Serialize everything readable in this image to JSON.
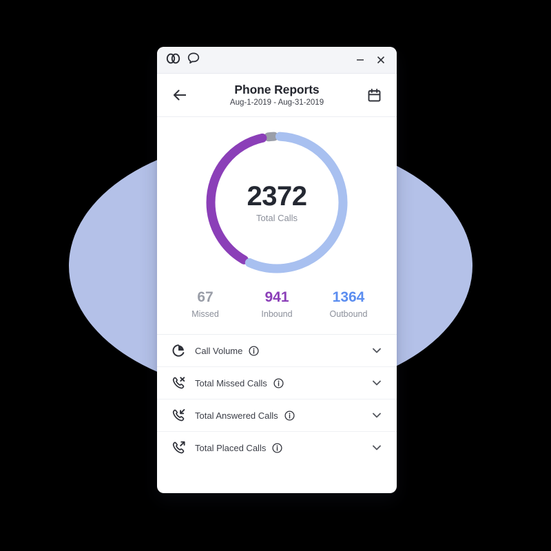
{
  "window": {
    "titlebar": {
      "logo_icon": "interlocking-rings-logo-icon",
      "chat_icon": "speech-bubble-icon",
      "minimize_label": "–",
      "close_label": "✕"
    },
    "header": {
      "back_icon": "arrow-left-icon",
      "title": "Phone Reports",
      "subtitle": "Aug-1-2019 - Aug-31-2019",
      "calendar_icon": "calendar-icon"
    }
  },
  "donut": {
    "total_value": "2372",
    "total_label": "Total Calls"
  },
  "stats": [
    {
      "value": "67",
      "label": "Missed",
      "color": "#9a9ea8"
    },
    {
      "value": "941",
      "label": "Inbound",
      "color": "#8b3fb8"
    },
    {
      "value": "1364",
      "label": "Outbound",
      "color": "#5b8df0"
    }
  ],
  "reports": [
    {
      "icon": "pie-chart-icon",
      "label": "Call Volume",
      "info_icon": "info-icon",
      "chevron_icon": "chevron-down-icon"
    },
    {
      "icon": "phone-missed-icon",
      "label": "Total Missed Calls",
      "info_icon": "info-icon",
      "chevron_icon": "chevron-down-icon"
    },
    {
      "icon": "phone-incoming-icon",
      "label": "Total Answered Calls",
      "info_icon": "info-icon",
      "chevron_icon": "chevron-down-icon"
    },
    {
      "icon": "phone-outgoing-icon",
      "label": "Total Placed Calls",
      "info_icon": "info-icon",
      "chevron_icon": "chevron-down-icon"
    }
  ],
  "theme": {
    "backdrop_ellipse_color": "#b4c1e8",
    "missed_color": "#9a9ea8",
    "inbound_color": "#8b3fb8",
    "outbound_color": "#a8c0f0",
    "canvas_color": "#000000"
  },
  "chart_data": {
    "type": "pie",
    "title": "Total Calls",
    "center_value": 2372,
    "labels": [
      "Missed",
      "Inbound",
      "Outbound"
    ],
    "values": [
      67,
      941,
      1364
    ],
    "colors": [
      "#9a9ea8",
      "#8b3fb8",
      "#a8c0f0"
    ],
    "percentages": [
      2.8,
      39.7,
      57.5
    ],
    "legend_position": "bottom",
    "grid": false
  }
}
